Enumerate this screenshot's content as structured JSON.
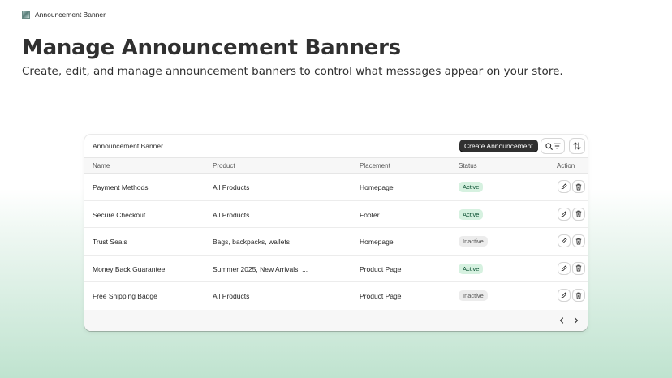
{
  "topbar": {
    "app_name": "Announcement Banner",
    "logo_icon": "app-logo-icon"
  },
  "page": {
    "title": "Manage Announcement Banners",
    "subtitle": "Create, edit, and manage announcement banners to control what messages appear on your store."
  },
  "card": {
    "title": "Announcement Banner",
    "create_label": "Create Announcement",
    "search_filter_icon": "search-filter-icon",
    "sort_icon": "sort-icon"
  },
  "table": {
    "headers": {
      "name": "Name",
      "product": "Product",
      "placement": "Placement",
      "status": "Status",
      "action": "Action"
    },
    "rows": [
      {
        "name": "Payment Methods",
        "product": "All Products",
        "placement": "Homepage",
        "status": "Active"
      },
      {
        "name": "Secure Checkout",
        "product": "All Products",
        "placement": "Footer",
        "status": "Active"
      },
      {
        "name": "Trust Seals",
        "product": "Bags, backpacks, wallets",
        "placement": "Homepage",
        "status": "Inactive"
      },
      {
        "name": "Money Back Guarantee",
        "product": "Summer 2025, New Arrivals, ...",
        "placement": "Product Page",
        "status": "Active"
      },
      {
        "name": "Free Shipping Badge",
        "product": "All Products",
        "placement": "Product Page",
        "status": "Inactive"
      }
    ]
  },
  "colors": {
    "active_bg": "#d6f1e0",
    "active_text": "#0c5132",
    "inactive_bg": "#ececec",
    "button_dark": "#303030"
  },
  "pagination": {
    "prev_icon": "chevron-left-icon",
    "next_icon": "chevron-right-icon"
  }
}
